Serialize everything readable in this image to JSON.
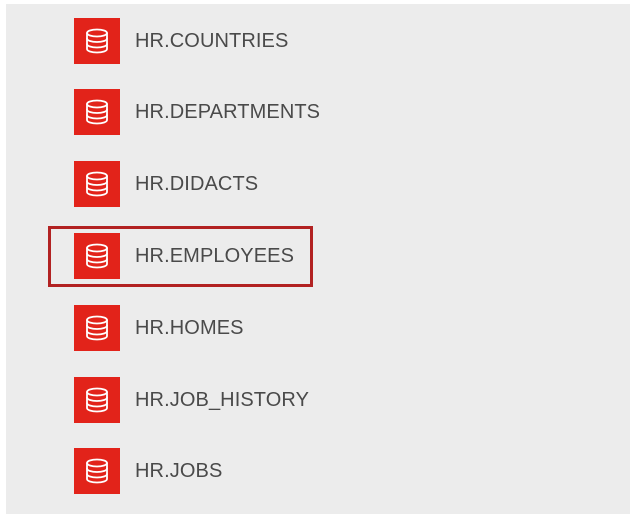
{
  "tables": [
    {
      "label": "HR.COUNTRIES",
      "icon": "database-icon",
      "selected": false
    },
    {
      "label": "HR.DEPARTMENTS",
      "icon": "database-icon",
      "selected": false
    },
    {
      "label": "HR.DIDACTS",
      "icon": "database-icon",
      "selected": false
    },
    {
      "label": "HR.EMPLOYEES",
      "icon": "database-icon",
      "selected": true
    },
    {
      "label": "HR.HOMES",
      "icon": "database-icon",
      "selected": false
    },
    {
      "label": "HR.JOB_HISTORY",
      "icon": "database-icon",
      "selected": false
    },
    {
      "label": "HR.JOBS",
      "icon": "database-icon",
      "selected": false
    }
  ],
  "colors": {
    "panel_background": "#ececec",
    "icon_background": "#e2231a",
    "icon_foreground": "#ffffff",
    "label_text": "#4a4a4a",
    "selection_border": "#b22222"
  }
}
